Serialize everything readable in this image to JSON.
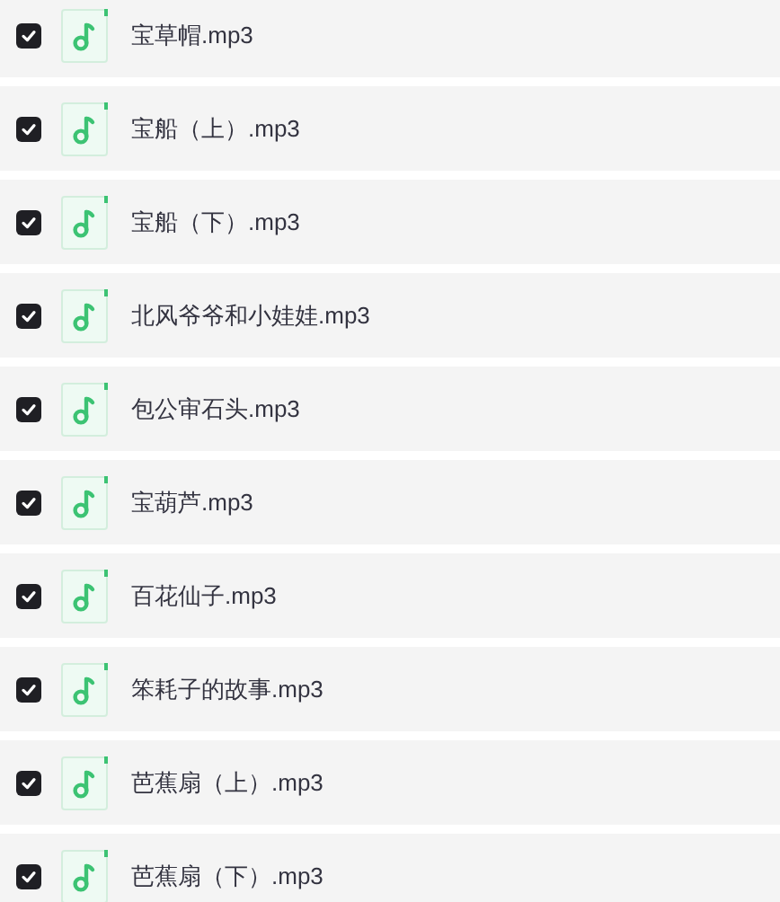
{
  "files": [
    {
      "name": "宝草帽.mp3",
      "checked": true
    },
    {
      "name": "宝船（上）.mp3",
      "checked": true
    },
    {
      "name": "宝船（下）.mp3",
      "checked": true
    },
    {
      "name": "北风爷爷和小娃娃.mp3",
      "checked": true
    },
    {
      "name": "包公审石头.mp3",
      "checked": true
    },
    {
      "name": "宝葫芦.mp3",
      "checked": true
    },
    {
      "name": "百花仙子.mp3",
      "checked": true
    },
    {
      "name": "笨耗子的故事.mp3",
      "checked": true
    },
    {
      "name": "芭蕉扇（上）.mp3",
      "checked": true
    },
    {
      "name": "芭蕉扇（下）.mp3",
      "checked": true
    }
  ]
}
